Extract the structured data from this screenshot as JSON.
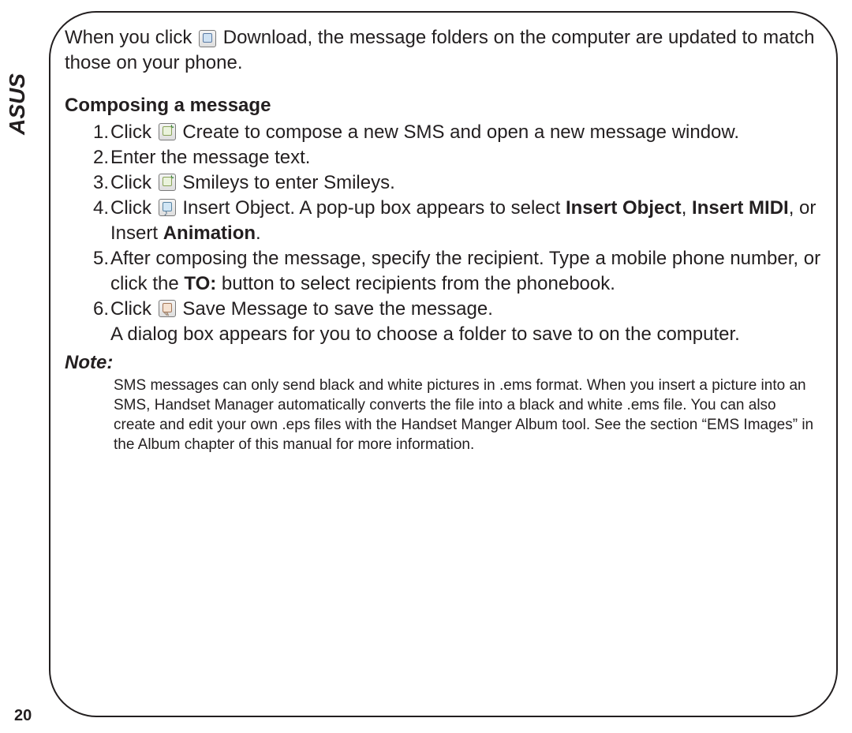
{
  "brand": "ASUS",
  "page_number": "20",
  "intro": {
    "before_icon": "When you click ",
    "after_icon": " Download, the message folders on the computer are updated to match those on your phone."
  },
  "section_heading": "Composing  a  message",
  "steps": {
    "1": {
      "num": "1.",
      "before_icon": "Click ",
      "after_icon": " Create to compose a new SMS and open a new message window."
    },
    "2": {
      "num": "2.",
      "text": "Enter the message text."
    },
    "3": {
      "num": "3.",
      "before_icon": "Click ",
      "after_icon": " Smileys to enter Smileys."
    },
    "4": {
      "num": "4.",
      "before_icon": "Click ",
      "after_icon_a": " Insert Object. A pop-up box appears to select ",
      "bold_a": "Insert Object",
      "mid_a": ", ",
      "bold_b": "Insert MIDI",
      "mid_b": ", or Insert ",
      "bold_c": "Animation",
      "tail": "."
    },
    "5": {
      "num": "5.",
      "a": "After composing the message, specify the recipient. Type a mobile phone number, or click the ",
      "bold_to": "TO:",
      "b": " button to select recipients from the phonebook."
    },
    "6": {
      "num": "6.",
      "before_icon": "Click ",
      "after_icon": " Save Message to save the message.",
      "line2": "A dialog box appears for you to choose a folder to save to on the computer."
    }
  },
  "note_label": "Note:",
  "note_body": "SMS messages can only send black and white pictures in .ems format. When you insert a picture into an SMS, Handset Manager automatically converts the file into a black and white .ems file. You can also create and edit your own .eps files with the Handset Manger Album tool. See the section “EMS Images” in the Album chapter of this manual for more information."
}
